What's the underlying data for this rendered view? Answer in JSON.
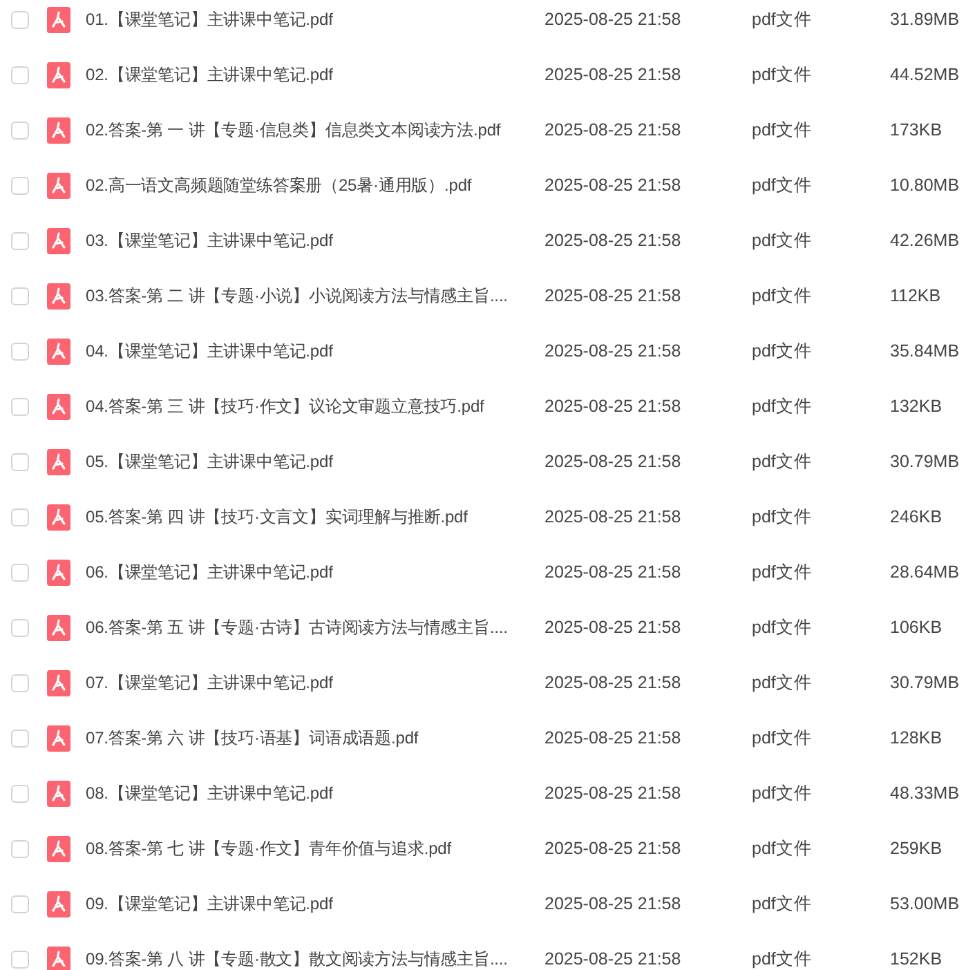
{
  "files": [
    {
      "name": "01.【课堂笔记】主讲课中笔记.pdf",
      "date": "2025-08-25 21:58",
      "type": "pdf文件",
      "size": "31.89MB",
      "checked": false
    },
    {
      "name": "02.【课堂笔记】主讲课中笔记.pdf",
      "date": "2025-08-25 21:58",
      "type": "pdf文件",
      "size": "44.52MB",
      "checked": false
    },
    {
      "name": "02.答案-第 一 讲【专题·信息类】信息类文本阅读方法.pdf",
      "date": "2025-08-25 21:58",
      "type": "pdf文件",
      "size": "173KB",
      "checked": false
    },
    {
      "name": "02.高一语文高频题随堂练答案册（25暑·通用版）.pdf",
      "date": "2025-08-25 21:58",
      "type": "pdf文件",
      "size": "10.80MB",
      "checked": false
    },
    {
      "name": "03.【课堂笔记】主讲课中笔记.pdf",
      "date": "2025-08-25 21:58",
      "type": "pdf文件",
      "size": "42.26MB",
      "checked": false
    },
    {
      "name": "03.答案-第 二 讲【专题·小说】小说阅读方法与情感主旨....",
      "date": "2025-08-25 21:58",
      "type": "pdf文件",
      "size": "112KB",
      "checked": false
    },
    {
      "name": "04.【课堂笔记】主讲课中笔记.pdf",
      "date": "2025-08-25 21:58",
      "type": "pdf文件",
      "size": "35.84MB",
      "checked": false
    },
    {
      "name": "04.答案-第 三 讲【技巧·作文】议论文审题立意技巧.pdf",
      "date": "2025-08-25 21:58",
      "type": "pdf文件",
      "size": "132KB",
      "checked": false
    },
    {
      "name": "05.【课堂笔记】主讲课中笔记.pdf",
      "date": "2025-08-25 21:58",
      "type": "pdf文件",
      "size": "30.79MB",
      "checked": false
    },
    {
      "name": "05.答案-第 四 讲【技巧·文言文】实词理解与推断.pdf",
      "date": "2025-08-25 21:58",
      "type": "pdf文件",
      "size": "246KB",
      "checked": false
    },
    {
      "name": "06.【课堂笔记】主讲课中笔记.pdf",
      "date": "2025-08-25 21:58",
      "type": "pdf文件",
      "size": "28.64MB",
      "checked": false
    },
    {
      "name": "06.答案-第 五 讲【专题·古诗】古诗阅读方法与情感主旨....",
      "date": "2025-08-25 21:58",
      "type": "pdf文件",
      "size": "106KB",
      "checked": false
    },
    {
      "name": "07.【课堂笔记】主讲课中笔记.pdf",
      "date": "2025-08-25 21:58",
      "type": "pdf文件",
      "size": "30.79MB",
      "checked": false
    },
    {
      "name": "07.答案-第 六 讲【技巧·语基】词语成语题.pdf",
      "date": "2025-08-25 21:58",
      "type": "pdf文件",
      "size": "128KB",
      "checked": false
    },
    {
      "name": "08.【课堂笔记】主讲课中笔记.pdf",
      "date": "2025-08-25 21:58",
      "type": "pdf文件",
      "size": "48.33MB",
      "checked": false
    },
    {
      "name": "08.答案-第 七 讲【专题·作文】青年价值与追求.pdf",
      "date": "2025-08-25 21:58",
      "type": "pdf文件",
      "size": "259KB",
      "checked": false
    },
    {
      "name": "09.【课堂笔记】主讲课中笔记.pdf",
      "date": "2025-08-25 21:58",
      "type": "pdf文件",
      "size": "53.00MB",
      "checked": false
    },
    {
      "name": "09.答案-第 八 讲【专题·散文】散文阅读方法与情感主旨....",
      "date": "2025-08-25 21:58",
      "type": "pdf文件",
      "size": "152KB",
      "checked": false
    }
  ]
}
